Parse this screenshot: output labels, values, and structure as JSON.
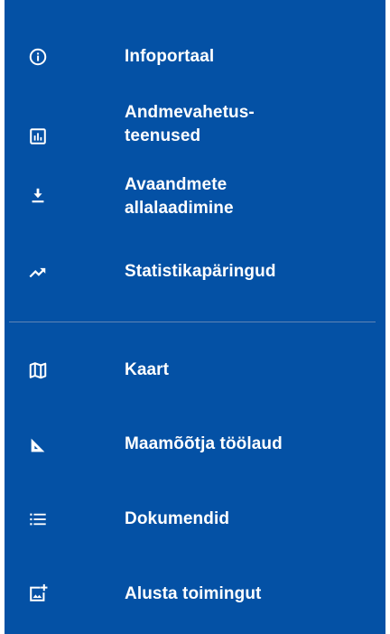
{
  "colors": {
    "menu_background": "#0451a5",
    "text": "#ffffff",
    "divider": "#5f84b6"
  },
  "menu": {
    "items": [
      {
        "label_lines": [
          "Infoportaal"
        ],
        "icon": "info-icon"
      },
      {
        "label_lines": [
          "Andmevahetus-",
          "teenused"
        ],
        "icon": "bar-chart-icon"
      },
      {
        "label_lines": [
          "Avaandmete",
          "allalaadimine"
        ],
        "icon": "download-icon"
      },
      {
        "label_lines": [
          "Statistikapäringud"
        ],
        "icon": "trending-up-icon"
      },
      {
        "label_lines": [
          "Kaart"
        ],
        "icon": "map-icon"
      },
      {
        "label_lines": [
          "Maamõõtja töölaud"
        ],
        "icon": "ruler-triangle-icon"
      },
      {
        "label_lines": [
          "Dokumendid"
        ],
        "icon": "list-icon"
      },
      {
        "label_lines": [
          "Alusta toimingut"
        ],
        "icon": "add-photo-icon"
      }
    ]
  }
}
